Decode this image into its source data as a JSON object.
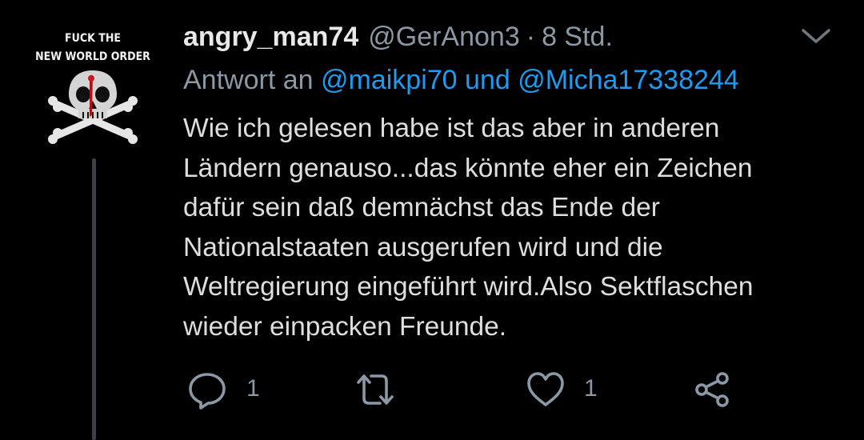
{
  "avatar": {
    "line1": "FUCK THE",
    "line2": "NEW WORLD ORDER"
  },
  "tweet": {
    "display_name": "angry_man74",
    "handle": "@GerAnon3",
    "separator": "·",
    "time": "8 Std.",
    "reply_prefix": "Antwort an",
    "reply_mention_1": "@maikpi70",
    "reply_and": "und",
    "reply_mention_2": "@Micha17338244",
    "body_lines": [
      "Wie ich gelesen habe ist das aber in anderen",
      "Ländern genauso...das könnte eher ein Zeichen",
      "dafür sein daß demnächst das Ende der",
      "Nationalstaaten ausgerufen wird und die",
      "Weltregierung eingeführt wird.Also Sektflaschen",
      "wieder einpacken Freunde."
    ]
  },
  "actions": {
    "reply_count": "1",
    "like_count": "1",
    "icons": [
      "reply-icon",
      "retweet-icon",
      "like-icon",
      "share-icon"
    ]
  },
  "colors": {
    "background": "#000000",
    "text": "#dedede",
    "muted": "#8b98a5",
    "accent": "#1d9bf0"
  }
}
